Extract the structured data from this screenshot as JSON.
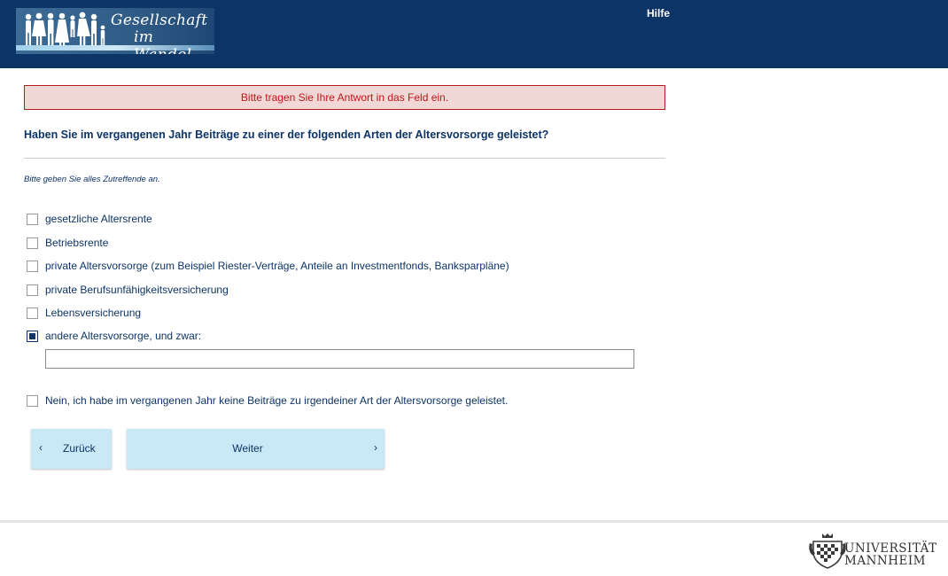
{
  "header": {
    "logo_line1": "Gesellschaft",
    "logo_line2": "im Wandel",
    "help_label": "Hilfe",
    "background_color": "#0d3466"
  },
  "error": {
    "message": "Bitte tragen Sie Ihre Antwort in das Feld ein.",
    "color": "#c0151a"
  },
  "question": {
    "text": "Haben Sie im vergangenen Jahr Beiträge zu einer der folgenden Arten der Altersvorsorge geleistet?",
    "instruction": "Bitte geben Sie alles Zutreffende an."
  },
  "options": [
    {
      "label": "gesetzliche Altersrente",
      "checked": false
    },
    {
      "label": "Betriebsrente",
      "checked": false
    },
    {
      "label": "private Altersvorsorge (zum Beispiel Riester-Verträge, Anteile an Investmentfonds, Banksparpläne)",
      "checked": false
    },
    {
      "label": "private Berufsunfähigkeitsversicherung",
      "checked": false
    },
    {
      "label": "Lebensversicherung",
      "checked": false
    },
    {
      "label": "andere Altersvorsorge, und zwar:",
      "checked": true
    },
    {
      "label": "Nein, ich habe im vergangenen Jahr keine Beiträge zu irgendeiner Art der Altersvorsorge geleistet.",
      "checked": false
    }
  ],
  "other_input": {
    "value": "",
    "placeholder": ""
  },
  "navigation": {
    "back_label": "Zurück",
    "next_label": "Weiter",
    "back_icon": "chevron-left-icon",
    "next_icon": "chevron-right-icon",
    "button_color": "#c9e9f7"
  },
  "footer": {
    "university_line1": "UNIVERSITÄT",
    "university_line2": "MANNHEIM"
  }
}
